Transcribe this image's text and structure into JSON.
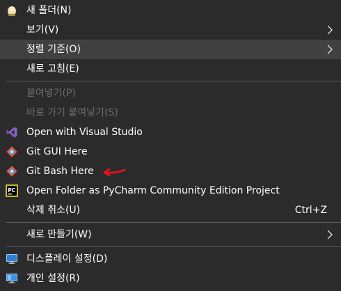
{
  "menu": {
    "items": [
      {
        "label": "새 폴더(N)",
        "icon": "new-folder-icon"
      },
      {
        "label": "보기(V)",
        "submenu": true
      },
      {
        "label": "정렬 기준(O)",
        "submenu": true,
        "highlighted": true
      },
      {
        "label": "새로 고침(E)"
      },
      {
        "label": "붙여넣기(P)",
        "disabled": true
      },
      {
        "label": "바로 가기 붙여넣기(S)",
        "disabled": true
      },
      {
        "label": "Open with Visual Studio",
        "icon": "visual-studio-icon"
      },
      {
        "label": "Git GUI Here",
        "icon": "git-icon"
      },
      {
        "label": "Git Bash Here",
        "icon": "git-icon"
      },
      {
        "label": "Open Folder as PyCharm Community Edition Project",
        "icon": "pycharm-icon"
      },
      {
        "label": "삭제 취소(U)",
        "shortcut": "Ctrl+Z"
      },
      {
        "label": "새로 만들기(W)",
        "submenu": true
      },
      {
        "label": "디스플레이 설정(D)",
        "icon": "display-settings-icon"
      },
      {
        "label": "개인 설정(R)",
        "icon": "personalize-icon"
      }
    ]
  },
  "colors": {
    "background": "#2b2b2b",
    "highlight": "#414141",
    "text": "#ffffff",
    "disabled_text": "#6d6d6d",
    "separator": "#5a5a5a",
    "annotation": "#d9161c"
  }
}
